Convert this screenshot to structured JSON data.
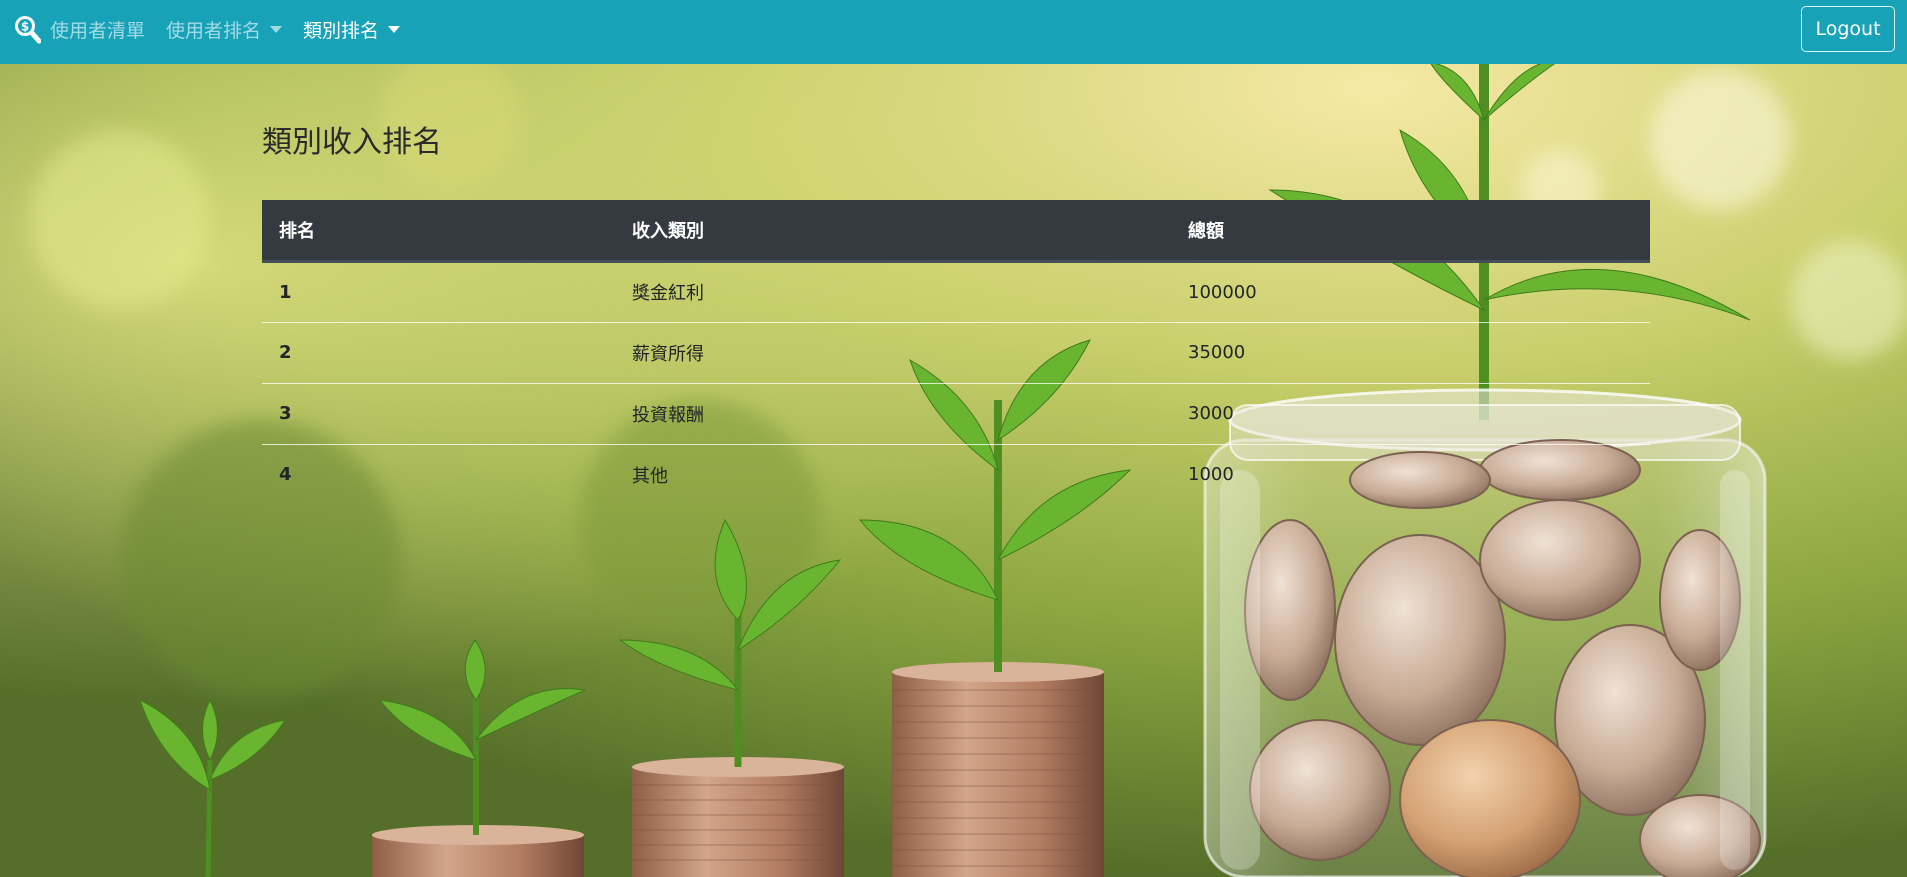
{
  "navbar": {
    "brand_icon": "search-dollar-icon",
    "items": [
      {
        "label": "使用者清單",
        "dropdown": false,
        "active": false
      },
      {
        "label": "使用者排名",
        "dropdown": true,
        "active": false
      },
      {
        "label": "類別排名",
        "dropdown": true,
        "active": true
      }
    ],
    "logout_label": "Logout",
    "color": "#17a2b8"
  },
  "main": {
    "title": "類別收入排名",
    "table": {
      "headers": [
        "排名",
        "收入類別",
        "總額"
      ],
      "rows": [
        {
          "rank": "1",
          "category": "獎金紅利",
          "total": "100000"
        },
        {
          "rank": "2",
          "category": "薪資所得",
          "total": "35000"
        },
        {
          "rank": "3",
          "category": "投資報酬",
          "total": "3000"
        },
        {
          "rank": "4",
          "category": "其他",
          "total": "1000"
        }
      ],
      "header_color": "#343a40"
    }
  },
  "background": {
    "description_icon": "coin-stacks-with-sprouts-image"
  }
}
